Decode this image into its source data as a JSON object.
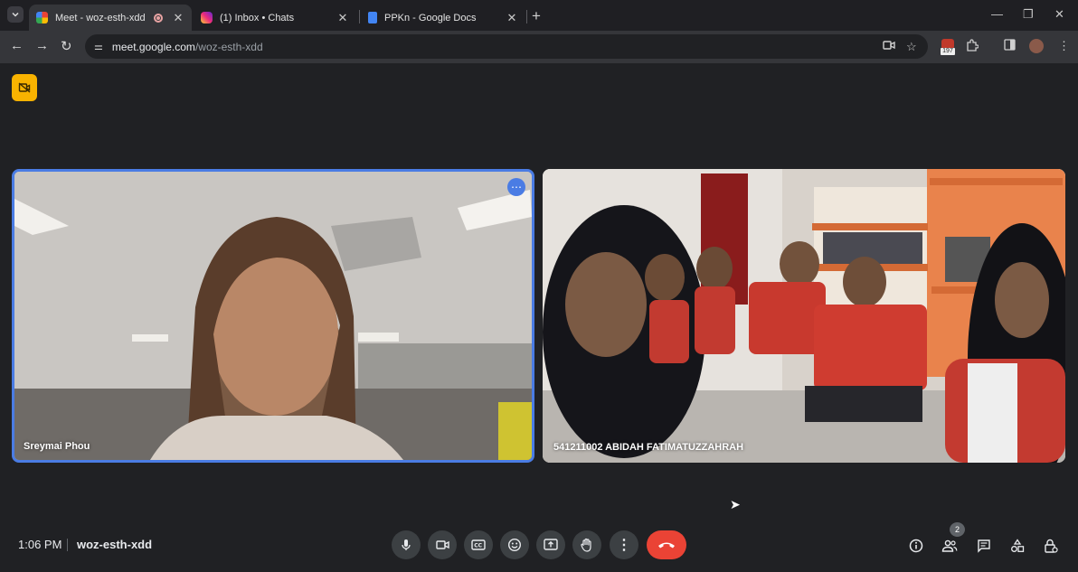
{
  "browser": {
    "tabs": [
      {
        "title": "Meet - woz-esth-xdd",
        "active": true,
        "favicon": "google-meet-icon",
        "recording": true
      },
      {
        "title": "(1) Inbox • Chats",
        "active": false,
        "favicon": "instagram-icon"
      },
      {
        "title": "PPKn - Google Docs",
        "active": false,
        "favicon": "google-docs-icon"
      }
    ],
    "new_tab": "+",
    "url_host": "meet.google.com",
    "url_path": "/woz-esth-xdd",
    "extension_badge": "197"
  },
  "meet": {
    "participants": [
      {
        "name": "Sreymai Phou",
        "active_speaker": true
      },
      {
        "name": "541211002 ABIDAH FATIMATUZZAHRAH",
        "active_speaker": false
      }
    ],
    "time": "1:06 PM",
    "meeting_code": "woz-esth-xdd",
    "people_count": "2"
  },
  "colors": {
    "accent": "#4a7ce4",
    "end_call": "#ea4335",
    "cam_off_badge": "#f9b300",
    "background": "#202124"
  },
  "icons": {
    "more": "⋯",
    "mic": "mic-icon",
    "camera": "camera-icon",
    "captions": "captions-icon",
    "emoji": "emoji-icon",
    "present": "present-icon",
    "raise_hand": "raise-hand-icon",
    "more_options": "more-vert-icon",
    "end_call": "end-call-icon",
    "info": "info-icon",
    "people": "people-icon",
    "chat": "chat-icon",
    "activities": "activities-icon",
    "host_controls": "host-controls-icon"
  }
}
